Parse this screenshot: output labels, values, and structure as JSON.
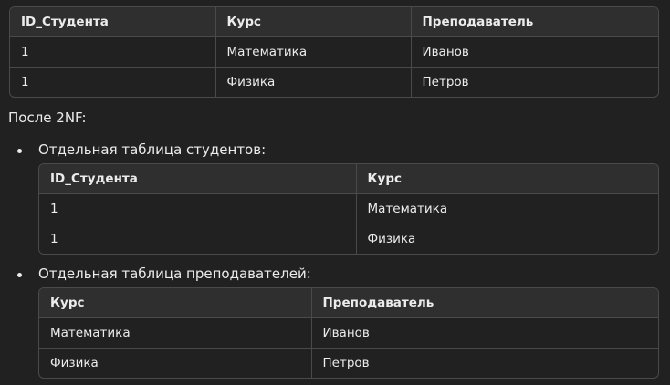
{
  "table1": {
    "headers": [
      "ID_Студента",
      "Курс",
      "Преподаватель"
    ],
    "rows": [
      [
        "1",
        "Математика",
        "Иванов"
      ],
      [
        "1",
        "Физика",
        "Петров"
      ]
    ]
  },
  "after_label": "После 2NF:",
  "bullet1": {
    "label": "Отдельная таблица студентов:",
    "headers": [
      "ID_Студента",
      "Курс"
    ],
    "rows": [
      [
        "1",
        "Математика"
      ],
      [
        "1",
        "Физика"
      ]
    ]
  },
  "bullet2": {
    "label": "Отдельная таблица преподавателей:",
    "headers": [
      "Курс",
      "Преподаватель"
    ],
    "rows": [
      [
        "Математика",
        "Иванов"
      ],
      [
        "Физика",
        "Петров"
      ]
    ]
  }
}
